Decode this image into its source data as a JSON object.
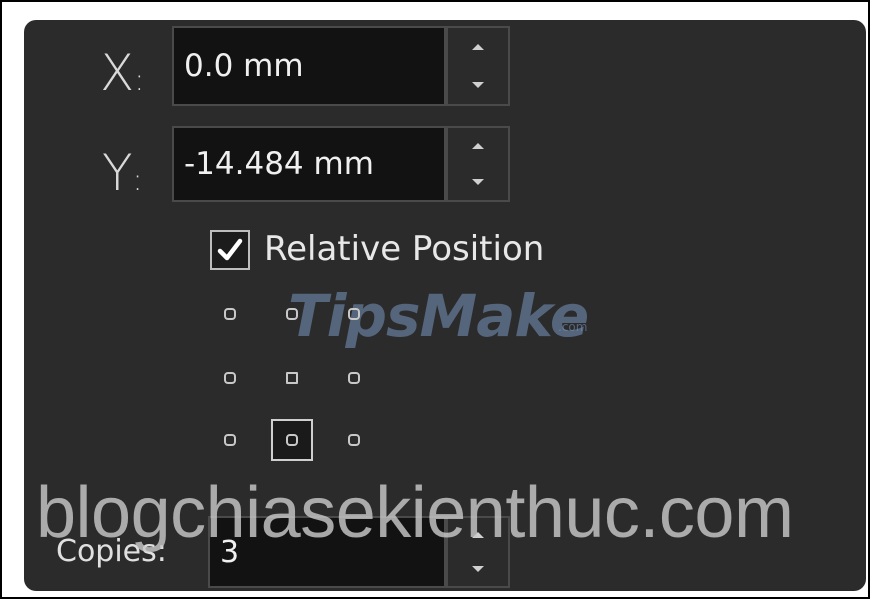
{
  "position": {
    "x": {
      "axis_letter": "X",
      "axis_colon": ":",
      "value": "0.0 mm"
    },
    "y": {
      "axis_letter": "Y",
      "axis_colon": ":",
      "value": "-14.484 mm"
    }
  },
  "relative_position": {
    "label": "Relative Position",
    "checked": true
  },
  "anchor_grid": {
    "rows": 3,
    "cols": 3,
    "selected": "bottom-center"
  },
  "copies": {
    "label": "Copies:",
    "value": "3"
  },
  "watermarks": {
    "tipsmake": "TipsMake",
    "tipsmake_suffix": ".com",
    "blog": "blogchiasekienthuc.com"
  },
  "icons": {
    "spin_up": "chevron-up-icon",
    "spin_down": "chevron-down-icon",
    "check": "checkmark-icon",
    "anchor": "anchor-point-icon"
  },
  "colors": {
    "panel_bg": "#2b2b2b",
    "field_bg": "#121212",
    "text": "#e8e8e8"
  }
}
